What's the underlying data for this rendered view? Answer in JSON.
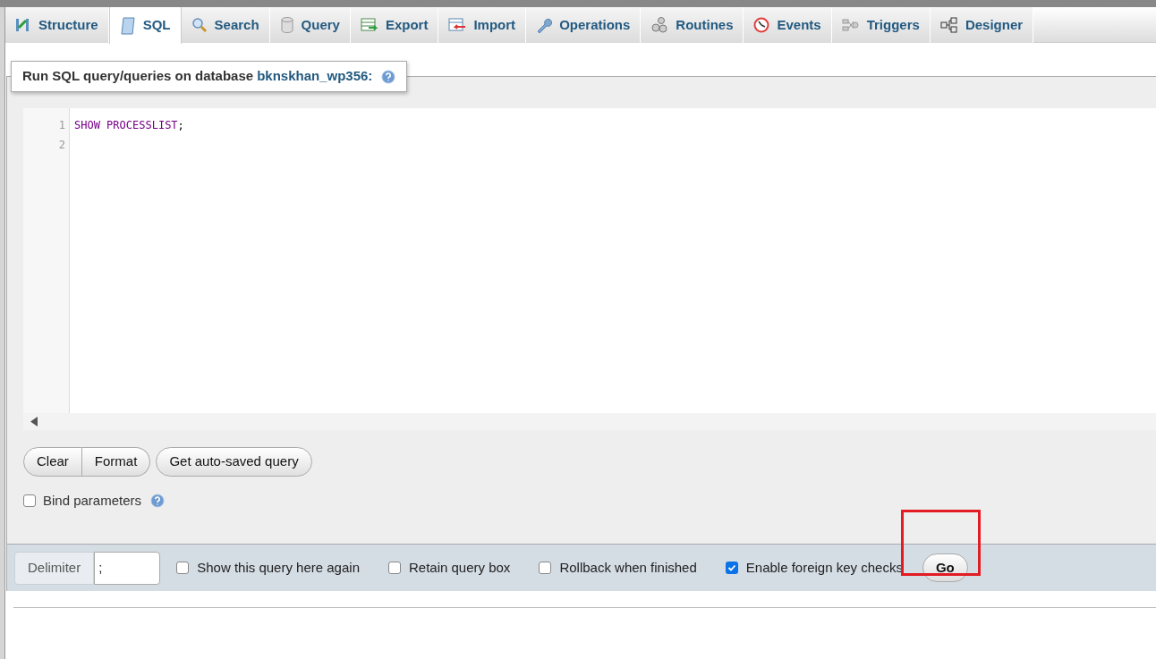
{
  "tabs": [
    {
      "label": "Structure",
      "selected": false
    },
    {
      "label": "SQL",
      "selected": true
    },
    {
      "label": "Search",
      "selected": false
    },
    {
      "label": "Query",
      "selected": false
    },
    {
      "label": "Export",
      "selected": false
    },
    {
      "label": "Import",
      "selected": false
    },
    {
      "label": "Operations",
      "selected": false
    },
    {
      "label": "Routines",
      "selected": false
    },
    {
      "label": "Events",
      "selected": false
    },
    {
      "label": "Triggers",
      "selected": false
    },
    {
      "label": "Designer",
      "selected": false
    }
  ],
  "panel": {
    "legend": "Run SQL query/queries on database",
    "database": "bknskhan_wp356:"
  },
  "editor": {
    "lines": [
      {
        "number": "1",
        "code": "SHOW PROCESSLIST",
        "end": ";"
      },
      {
        "number": "2"
      }
    ]
  },
  "button_groups": [
    [
      "Clear",
      "Format"
    ],
    [
      "Get auto-saved query"
    ]
  ],
  "bind_parameters": {
    "label": "Bind parameters",
    "checked": false
  },
  "footer": {
    "delimiter_label": "Delimiter",
    "delimiter_value": ";",
    "options": [
      {
        "label": "Show this query here again",
        "checked": false
      },
      {
        "label": "Retain query box",
        "checked": false
      },
      {
        "label": "Rollback when finished",
        "checked": false
      },
      {
        "label": "Enable foreign key checks",
        "checked": true
      }
    ],
    "go": "Go"
  },
  "annotation": {
    "kind": "highlight-box",
    "color": "#e31b23"
  }
}
